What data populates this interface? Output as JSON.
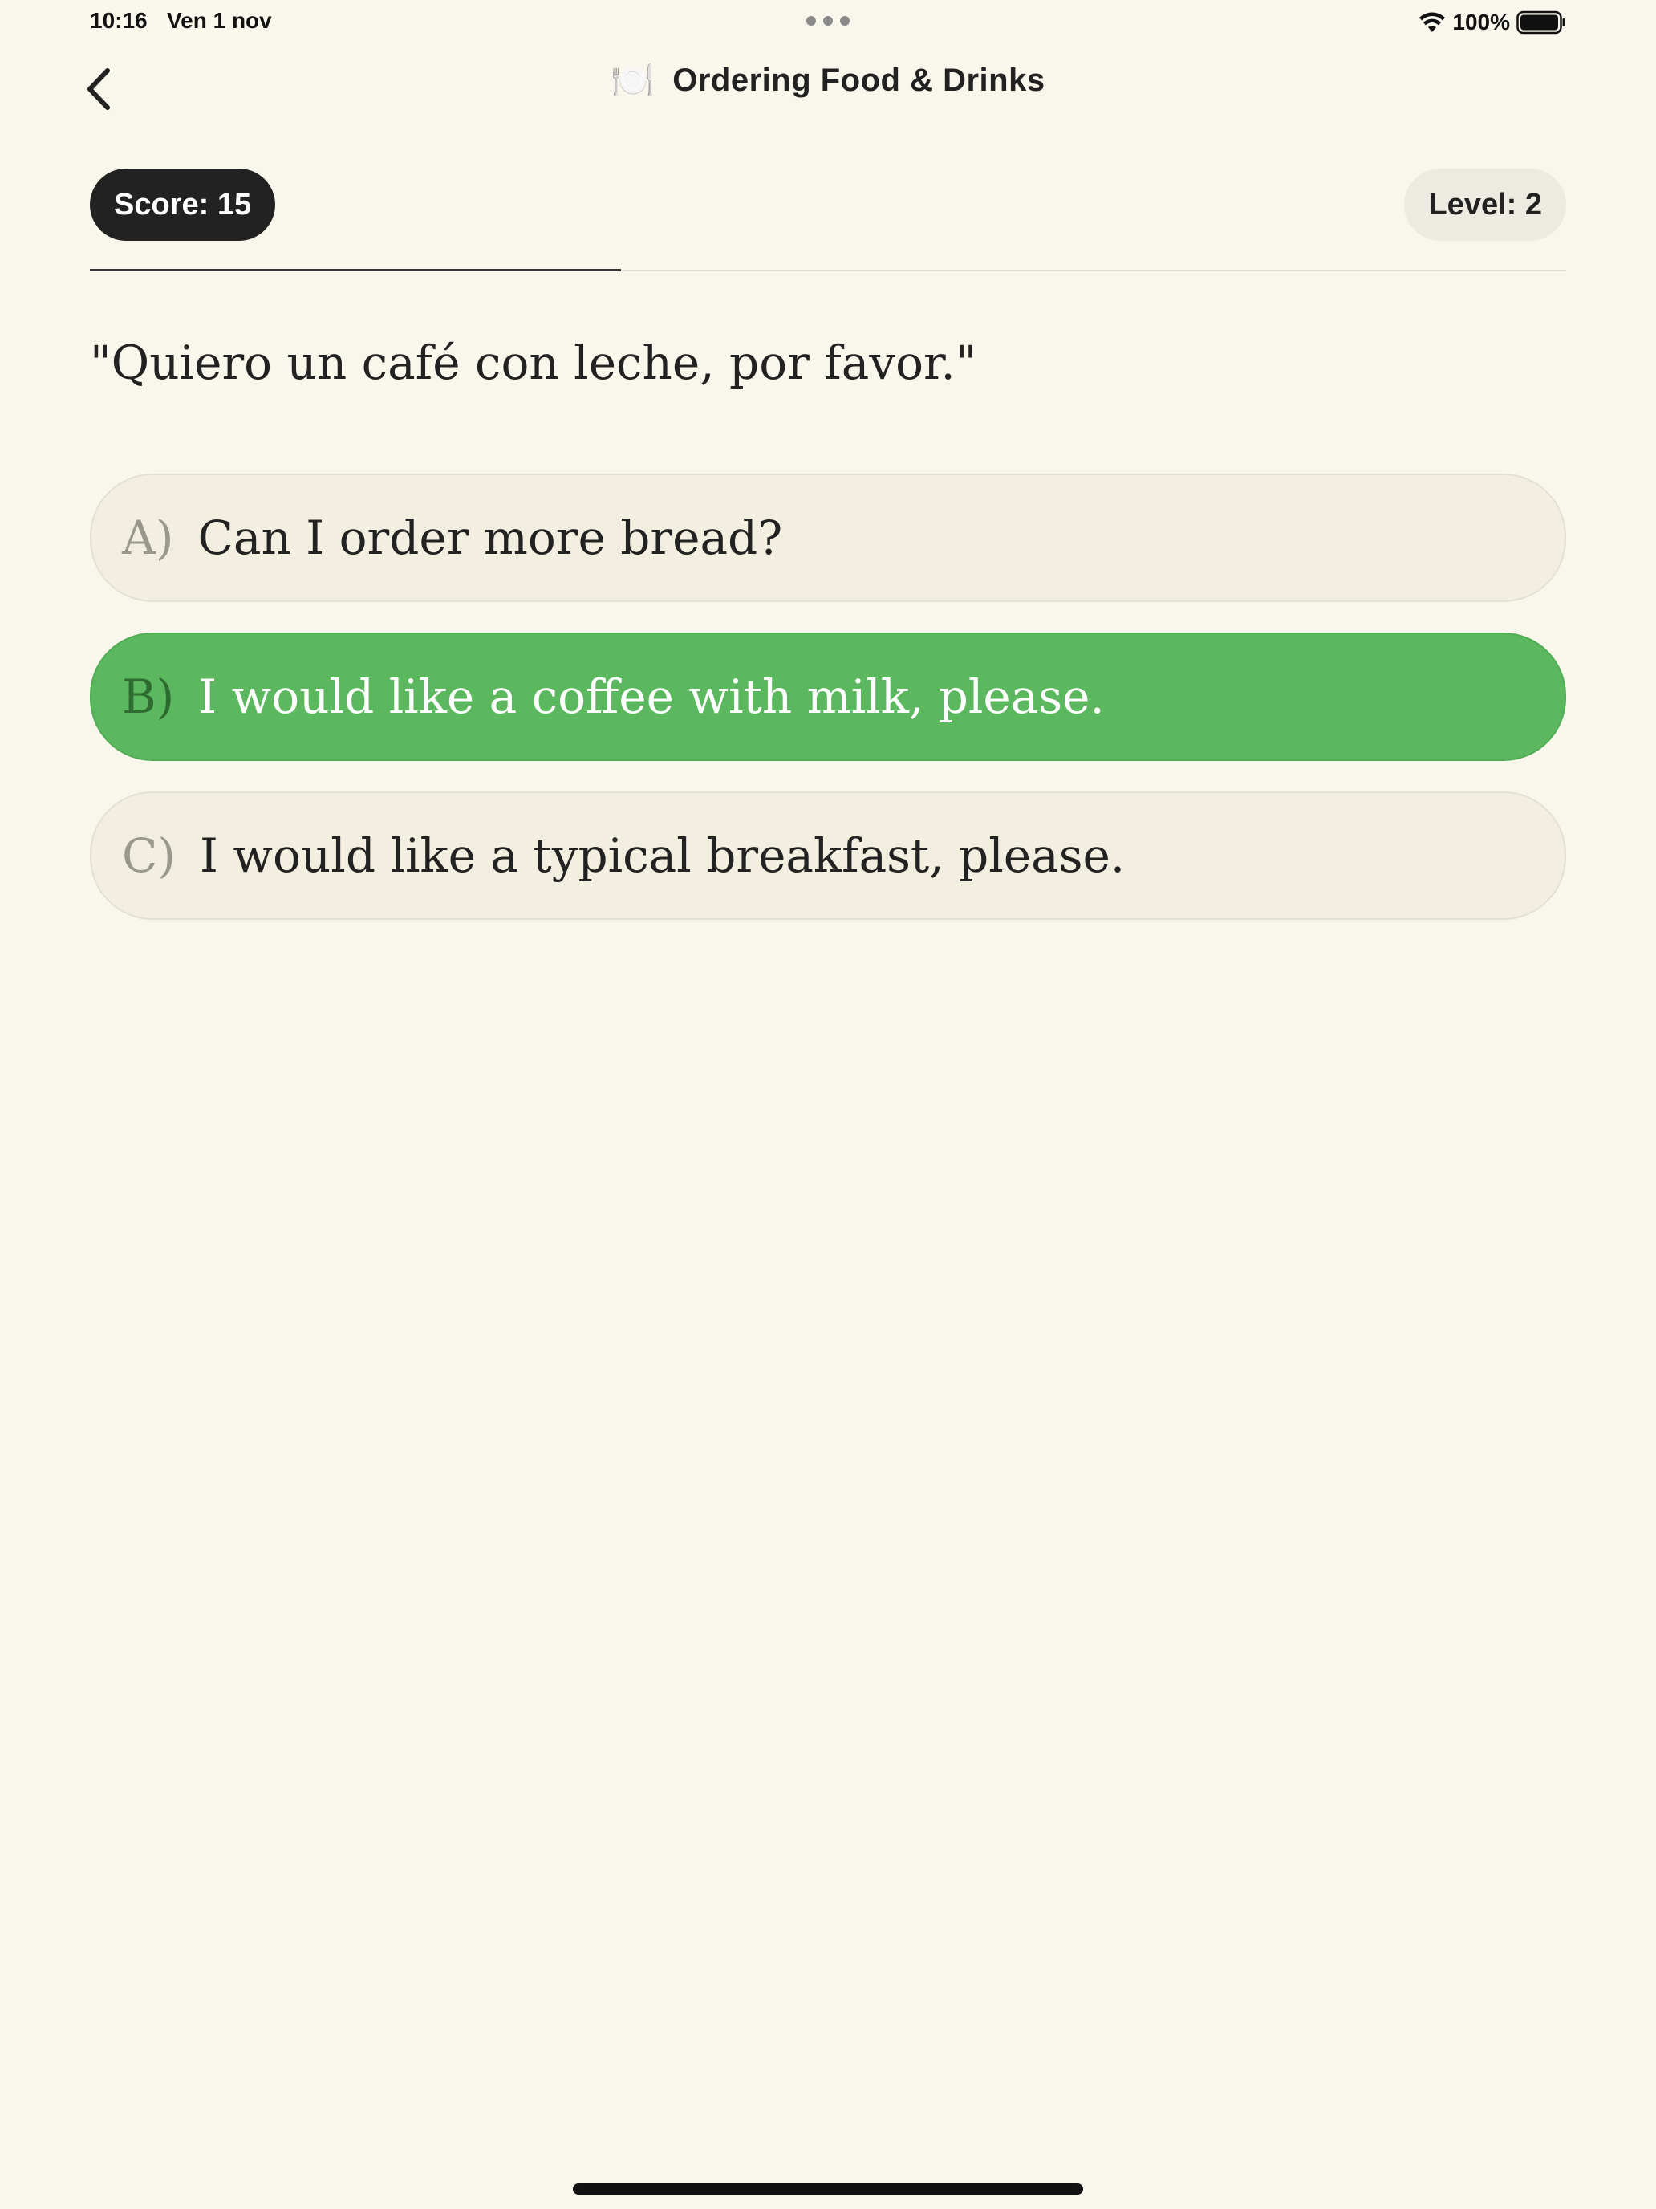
{
  "status_bar": {
    "time": "10:16",
    "date": "Ven 1 nov",
    "battery": "100%"
  },
  "nav": {
    "icon": "🍽️",
    "title": "Ordering Food & Drinks"
  },
  "score_label": "Score: 15",
  "level_label": "Level: 2",
  "progress": 0.36,
  "prompt": "\"Quiero un café con leche, por favor.\"",
  "options": [
    {
      "letter": "A)",
      "text": "Can I order more bread?",
      "selected": false
    },
    {
      "letter": "B)",
      "text": "I would like a coffee with milk, please.",
      "selected": true
    },
    {
      "letter": "C)",
      "text": "I would like a typical breakfast, please.",
      "selected": false
    }
  ],
  "colors": {
    "background": "#f9f7ec",
    "selected_option": "#5cb85f",
    "option": "#f2efe0",
    "score_pill": "#222222",
    "level_pill": "#eceae1"
  }
}
